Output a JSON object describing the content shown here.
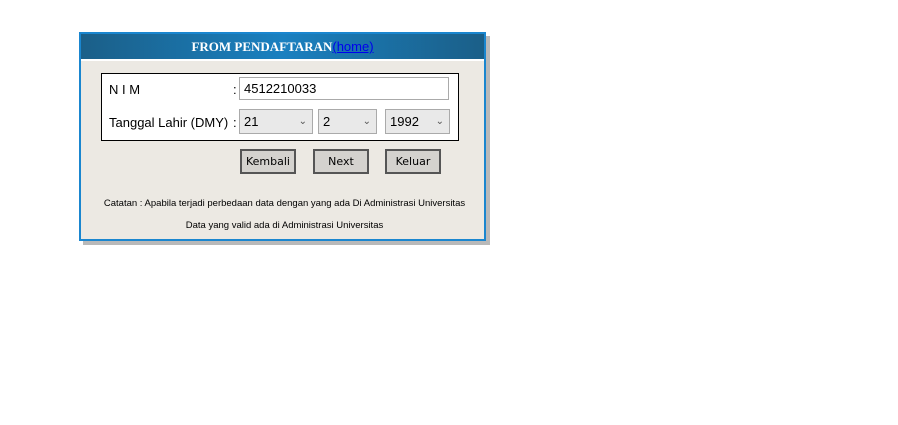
{
  "header": {
    "title": "FROM PENDAFTARAN",
    "home_link": "(home)"
  },
  "form": {
    "nim_label": "N I M",
    "colon": ":",
    "nim_value": "4512210033",
    "dob_label": "Tanggal Lahir (DMY)",
    "day": "21",
    "month": "2",
    "year": "1992"
  },
  "buttons": {
    "back": "Kembali",
    "next": "Next",
    "exit": "Keluar"
  },
  "notes": [
    "Catatan : Apabila terjadi perbedaan data dengan yang ada Di Administrasi Universitas",
    "Data yang valid ada di Administrasi Universitas"
  ]
}
